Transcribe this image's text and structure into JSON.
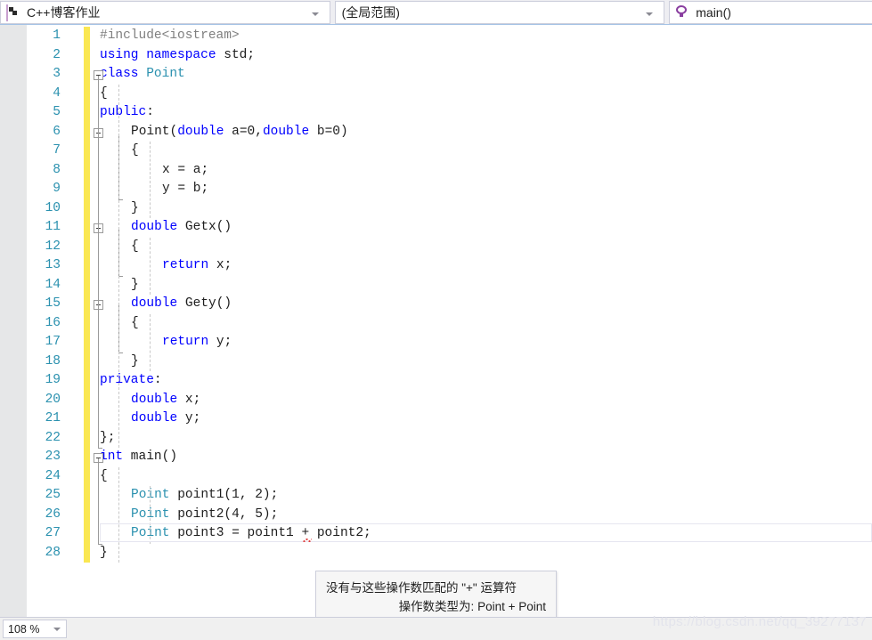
{
  "navbar": {
    "project": {
      "icon": "cpp-file-icon",
      "value": "C++博客作业",
      "arrow": "chevron-down-icon"
    },
    "scope": {
      "value": "(全局范围)",
      "arrow": "chevron-down-icon"
    },
    "member": {
      "icon": "method-icon",
      "value": "main()"
    }
  },
  "editor": {
    "lines": [
      {
        "n": "1",
        "indent": 0,
        "tokens": [
          {
            "t": "#include<iostream>",
            "c": "pre"
          }
        ]
      },
      {
        "n": "2",
        "indent": 0,
        "tokens": [
          {
            "t": "using",
            "c": "kw"
          },
          {
            "t": " ",
            "c": "pln"
          },
          {
            "t": "namespace",
            "c": "kw"
          },
          {
            "t": " std;",
            "c": "pln"
          }
        ]
      },
      {
        "n": "3",
        "indent": 0,
        "tokens": [
          {
            "t": "class",
            "c": "kw"
          },
          {
            "t": " ",
            "c": "pln"
          },
          {
            "t": "Point",
            "c": "typ"
          }
        ]
      },
      {
        "n": "4",
        "indent": 0,
        "tokens": [
          {
            "t": "{",
            "c": "pln"
          }
        ]
      },
      {
        "n": "5",
        "indent": 0,
        "tokens": [
          {
            "t": "public",
            "c": "kw"
          },
          {
            "t": ":",
            "c": "pln"
          }
        ]
      },
      {
        "n": "6",
        "indent": 1,
        "tokens": [
          {
            "t": "Point(",
            "c": "pln"
          },
          {
            "t": "double",
            "c": "kw"
          },
          {
            "t": " a=0,",
            "c": "pln"
          },
          {
            "t": "double",
            "c": "kw"
          },
          {
            "t": " b=0)",
            "c": "pln"
          }
        ]
      },
      {
        "n": "7",
        "indent": 1,
        "tokens": [
          {
            "t": "{",
            "c": "pln"
          }
        ]
      },
      {
        "n": "8",
        "indent": 2,
        "tokens": [
          {
            "t": "x = a;",
            "c": "pln"
          }
        ]
      },
      {
        "n": "9",
        "indent": 2,
        "tokens": [
          {
            "t": "y = b;",
            "c": "pln"
          }
        ]
      },
      {
        "n": "10",
        "indent": 1,
        "tokens": [
          {
            "t": "}",
            "c": "pln"
          }
        ]
      },
      {
        "n": "11",
        "indent": 1,
        "tokens": [
          {
            "t": "double",
            "c": "kw"
          },
          {
            "t": " Getx()",
            "c": "pln"
          }
        ]
      },
      {
        "n": "12",
        "indent": 1,
        "tokens": [
          {
            "t": "{",
            "c": "pln"
          }
        ]
      },
      {
        "n": "13",
        "indent": 2,
        "tokens": [
          {
            "t": "return",
            "c": "kw"
          },
          {
            "t": " x;",
            "c": "pln"
          }
        ]
      },
      {
        "n": "14",
        "indent": 1,
        "tokens": [
          {
            "t": "}",
            "c": "pln"
          }
        ]
      },
      {
        "n": "15",
        "indent": 1,
        "tokens": [
          {
            "t": "double",
            "c": "kw"
          },
          {
            "t": " Gety()",
            "c": "pln"
          }
        ]
      },
      {
        "n": "16",
        "indent": 1,
        "tokens": [
          {
            "t": "{",
            "c": "pln"
          }
        ]
      },
      {
        "n": "17",
        "indent": 2,
        "tokens": [
          {
            "t": "return",
            "c": "kw"
          },
          {
            "t": " y;",
            "c": "pln"
          }
        ]
      },
      {
        "n": "18",
        "indent": 1,
        "tokens": [
          {
            "t": "}",
            "c": "pln"
          }
        ]
      },
      {
        "n": "19",
        "indent": 0,
        "tokens": [
          {
            "t": "private",
            "c": "kw"
          },
          {
            "t": ":",
            "c": "pln"
          }
        ]
      },
      {
        "n": "20",
        "indent": 1,
        "tokens": [
          {
            "t": "double",
            "c": "kw"
          },
          {
            "t": " x;",
            "c": "pln"
          }
        ]
      },
      {
        "n": "21",
        "indent": 1,
        "tokens": [
          {
            "t": "double",
            "c": "kw"
          },
          {
            "t": " y;",
            "c": "pln"
          }
        ]
      },
      {
        "n": "22",
        "indent": 0,
        "tokens": [
          {
            "t": "};",
            "c": "pln"
          }
        ]
      },
      {
        "n": "23",
        "indent": 0,
        "tokens": [
          {
            "t": "int",
            "c": "kw"
          },
          {
            "t": " main()",
            "c": "pln"
          }
        ]
      },
      {
        "n": "24",
        "indent": 0,
        "tokens": [
          {
            "t": "{",
            "c": "pln"
          }
        ]
      },
      {
        "n": "25",
        "indent": 1,
        "tokens": [
          {
            "t": "Point",
            "c": "typ"
          },
          {
            "t": " point1(1, 2);",
            "c": "pln"
          }
        ]
      },
      {
        "n": "26",
        "indent": 1,
        "tokens": [
          {
            "t": "Point",
            "c": "typ"
          },
          {
            "t": " point2(4, 5);",
            "c": "pln"
          }
        ]
      },
      {
        "n": "27",
        "indent": 1,
        "tokens": [
          {
            "t": "Point",
            "c": "typ"
          },
          {
            "t": " point3 = point1 + point2;",
            "c": "pln"
          }
        ]
      },
      {
        "n": "28",
        "indent": 0,
        "tokens": [
          {
            "t": "}",
            "c": "pln"
          }
        ]
      }
    ]
  },
  "tooltip": {
    "line1": "没有与这些操作数匹配的 \"+\" 运算符",
    "line2": "操作数类型为: Point + Point"
  },
  "statusbar": {
    "zoom": "108 %",
    "zoom_arrow": "chevron-down-icon"
  },
  "watermark": "https://blog.csdn.net/qq_39277137",
  "colors": {
    "keyword": "#0000FF",
    "type": "#2B91AF",
    "preprocessor": "#808080",
    "plain": "#1E1E1E",
    "line_number": "#2B91AF",
    "change_bar": "#FAE752",
    "squiggle": "#E04343",
    "accent_border": "#A5C3E6",
    "chrome": "#EEEEF2"
  }
}
